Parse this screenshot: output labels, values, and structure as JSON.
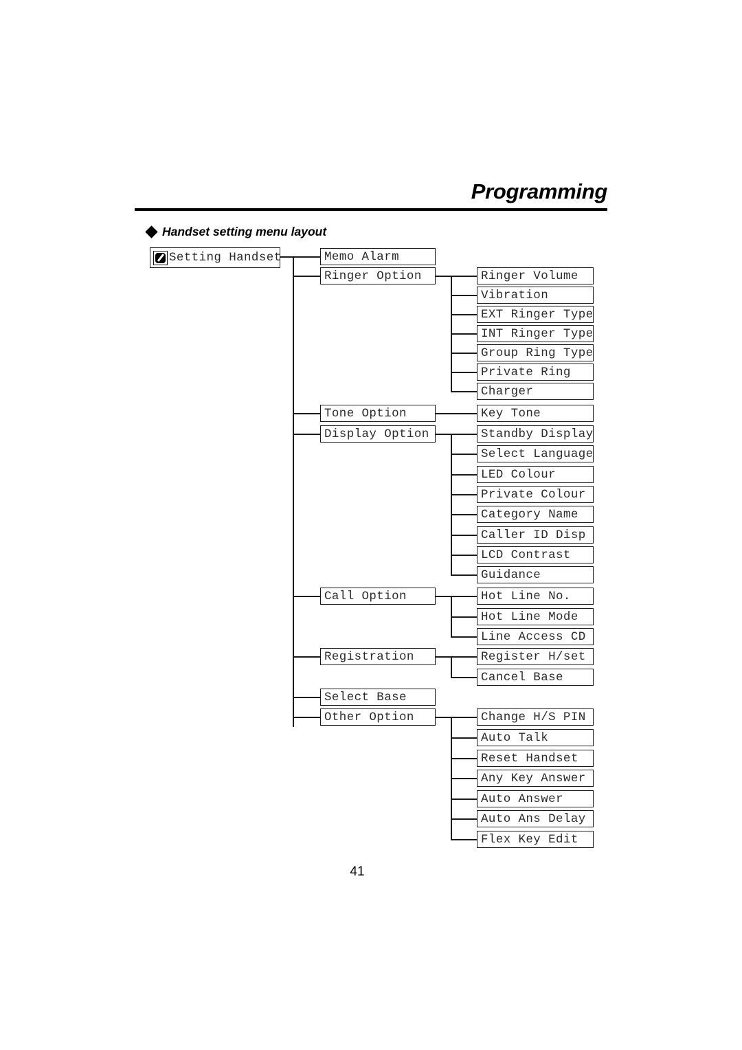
{
  "header": {
    "title": "Programming"
  },
  "section": {
    "bullet_icon": "diamond-bullet-icon",
    "heading": "Handset setting menu layout"
  },
  "page_number": "41",
  "tree": {
    "root": {
      "icon": "handset-icon",
      "label": "Setting Handset"
    },
    "level1": [
      {
        "label": "Memo Alarm",
        "children": []
      },
      {
        "label": "Ringer Option",
        "children": [
          "Ringer Volume",
          "Vibration",
          "EXT Ringer Type",
          "INT Ringer Type",
          "Group Ring Type",
          "Private Ring",
          "Charger"
        ]
      },
      {
        "label": "Tone Option",
        "children": [
          "Key Tone"
        ]
      },
      {
        "label": "Display Option",
        "children": [
          "Standby Display",
          "Select Language",
          "LED Colour",
          "Private Colour",
          "Category Name",
          "Caller ID Disp",
          "LCD Contrast",
          "Guidance"
        ]
      },
      {
        "label": "Call Option",
        "children": [
          "Hot Line No.",
          "Hot Line Mode",
          "Line Access CD"
        ]
      },
      {
        "label": "Registration",
        "children": [
          "Register H/set",
          "Cancel Base"
        ]
      },
      {
        "label": "Select Base",
        "children": []
      },
      {
        "label": "Other Option",
        "children": [
          "Change H/S PIN",
          "Auto Talk",
          "Reset Handset",
          "Any Key Answer",
          "Auto Answer",
          "Auto Ans Delay",
          "Flex Key Edit"
        ]
      }
    ]
  }
}
